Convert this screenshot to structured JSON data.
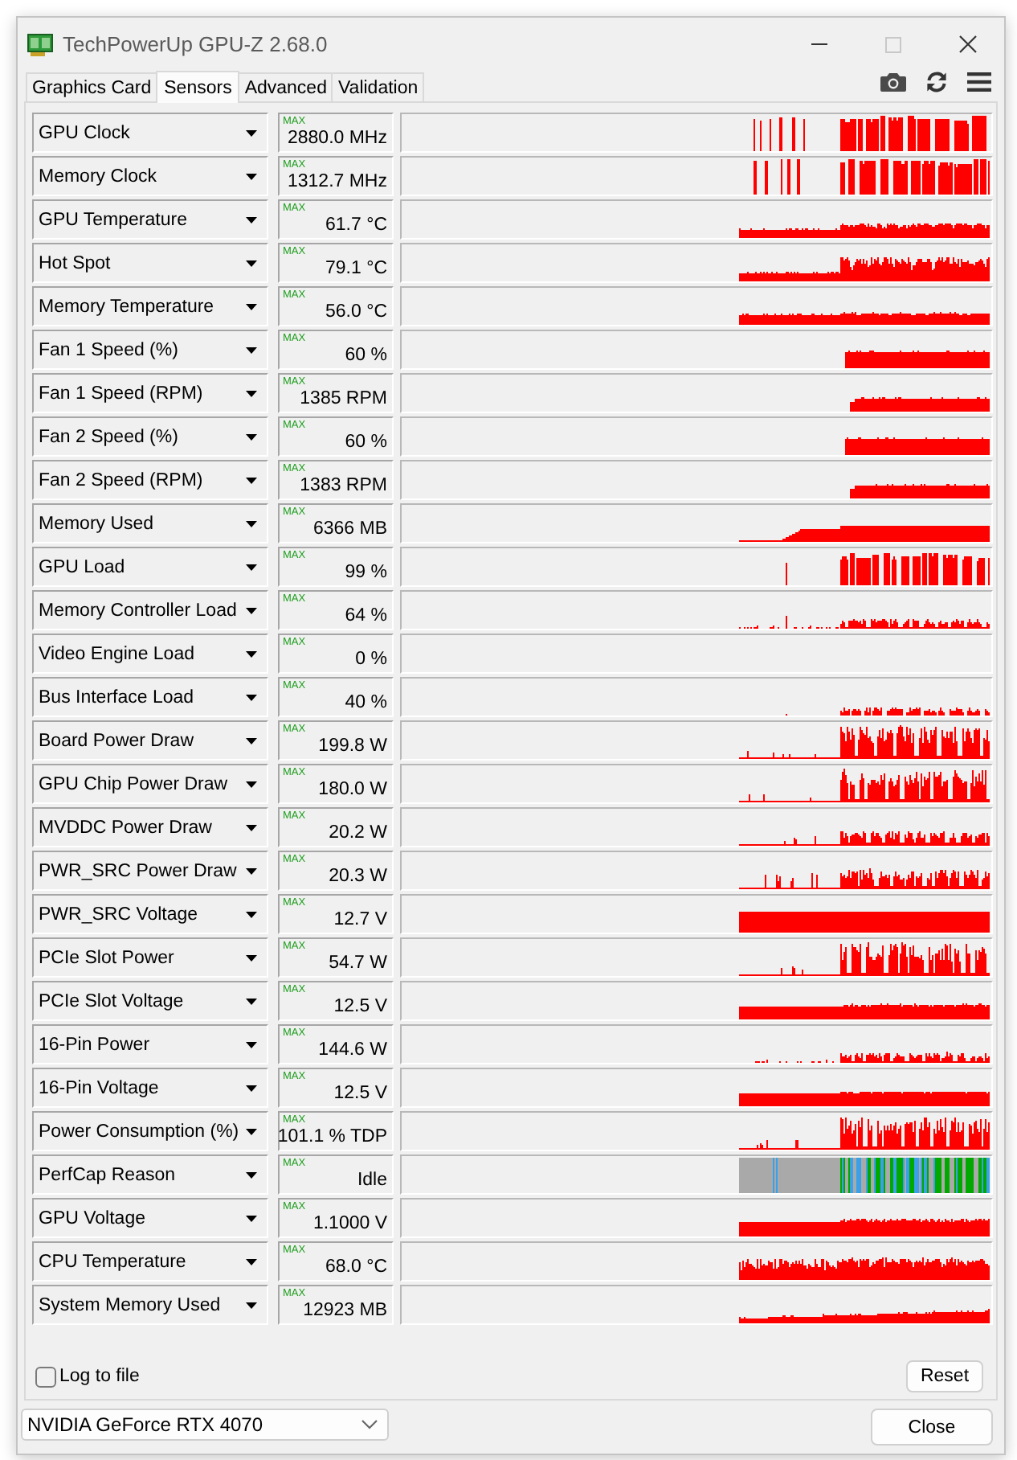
{
  "window": {
    "title": "TechPowerUp GPU-Z 2.68.0",
    "maximize_disabled": true
  },
  "tabs": [
    {
      "label": "Graphics Card",
      "selected": false
    },
    {
      "label": "Sensors",
      "selected": true
    },
    {
      "label": "Advanced",
      "selected": false
    },
    {
      "label": "Validation",
      "selected": false
    }
  ],
  "sensors": [
    {
      "name": "GPU Clock",
      "stat": "MAX",
      "value": "2880.0 MHz"
    },
    {
      "name": "Memory Clock",
      "stat": "MAX",
      "value": "1312.7 MHz"
    },
    {
      "name": "GPU Temperature",
      "stat": "MAX",
      "value": "61.7 °C"
    },
    {
      "name": "Hot Spot",
      "stat": "MAX",
      "value": "79.1 °C"
    },
    {
      "name": "Memory Temperature",
      "stat": "MAX",
      "value": "56.0 °C"
    },
    {
      "name": "Fan 1 Speed (%)",
      "stat": "MAX",
      "value": "60 %"
    },
    {
      "name": "Fan 1 Speed (RPM)",
      "stat": "MAX",
      "value": "1385 RPM"
    },
    {
      "name": "Fan 2 Speed (%)",
      "stat": "MAX",
      "value": "60 %"
    },
    {
      "name": "Fan 2 Speed (RPM)",
      "stat": "MAX",
      "value": "1383 RPM"
    },
    {
      "name": "Memory Used",
      "stat": "MAX",
      "value": "6366 MB"
    },
    {
      "name": "GPU Load",
      "stat": "MAX",
      "value": "99 %"
    },
    {
      "name": "Memory Controller Load",
      "stat": "MAX",
      "value": "64 %"
    },
    {
      "name": "Video Engine Load",
      "stat": "MAX",
      "value": "0 %"
    },
    {
      "name": "Bus Interface Load",
      "stat": "MAX",
      "value": "40 %"
    },
    {
      "name": "Board Power Draw",
      "stat": "MAX",
      "value": "199.8 W"
    },
    {
      "name": "GPU Chip Power Draw",
      "stat": "MAX",
      "value": "180.0 W"
    },
    {
      "name": "MVDDC Power Draw",
      "stat": "MAX",
      "value": "20.2 W"
    },
    {
      "name": "PWR_SRC Power Draw",
      "stat": "MAX",
      "value": "20.3 W"
    },
    {
      "name": "PWR_SRC Voltage",
      "stat": "MAX",
      "value": "12.7 V"
    },
    {
      "name": "PCIe Slot Power",
      "stat": "MAX",
      "value": "54.7 W"
    },
    {
      "name": "PCIe Slot Voltage",
      "stat": "MAX",
      "value": "12.5 V"
    },
    {
      "name": "16-Pin Power",
      "stat": "MAX",
      "value": "144.6 W"
    },
    {
      "name": "16-Pin Voltage",
      "stat": "MAX",
      "value": "12.5 V"
    },
    {
      "name": "Power Consumption (%)",
      "stat": "MAX",
      "value": "101.1 % TDP"
    },
    {
      "name": "PerfCap Reason",
      "stat": "MAX",
      "value": "Idle"
    },
    {
      "name": "GPU Voltage",
      "stat": "MAX",
      "value": "1.1000 V"
    },
    {
      "name": "CPU Temperature",
      "stat": "MAX",
      "value": "68.0 °C"
    },
    {
      "name": "System Memory Used",
      "stat": "MAX",
      "value": "12923 MB"
    }
  ],
  "log_to_file": {
    "label": "Log to file",
    "checked": false
  },
  "reset_button": "Reset",
  "gpu_select": {
    "value": "NVIDIA GeForce RTX 4070"
  },
  "close_button": "Close"
}
